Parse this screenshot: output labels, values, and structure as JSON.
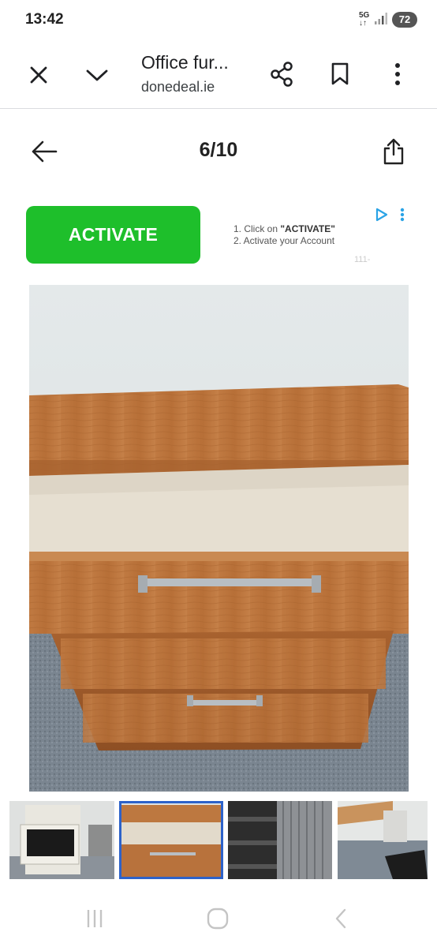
{
  "status_bar": {
    "time": "13:42",
    "network": "5G",
    "battery": "72"
  },
  "toolbar": {
    "title": "Office fur...",
    "domain": "donedeal.ie"
  },
  "gallery": {
    "counter": "6/10"
  },
  "ad": {
    "button_label": "ACTIVATE",
    "step1_prefix": "1. Click on ",
    "step1_bold": "\"ACTIVATE\"",
    "step2": "2. Activate your Account",
    "faint_text": "111-"
  },
  "colors": {
    "accent_green": "#1ebf2b",
    "thumb_selected": "#2d62c9",
    "wood": "#b8703b"
  },
  "icons": [
    "close-icon",
    "chevron-down-icon",
    "share-icon",
    "bookmark-icon",
    "more-vert-icon",
    "back-arrow-icon",
    "share-upload-icon",
    "ad-choices-icon",
    "recent-apps-icon",
    "home-icon",
    "back-icon"
  ]
}
